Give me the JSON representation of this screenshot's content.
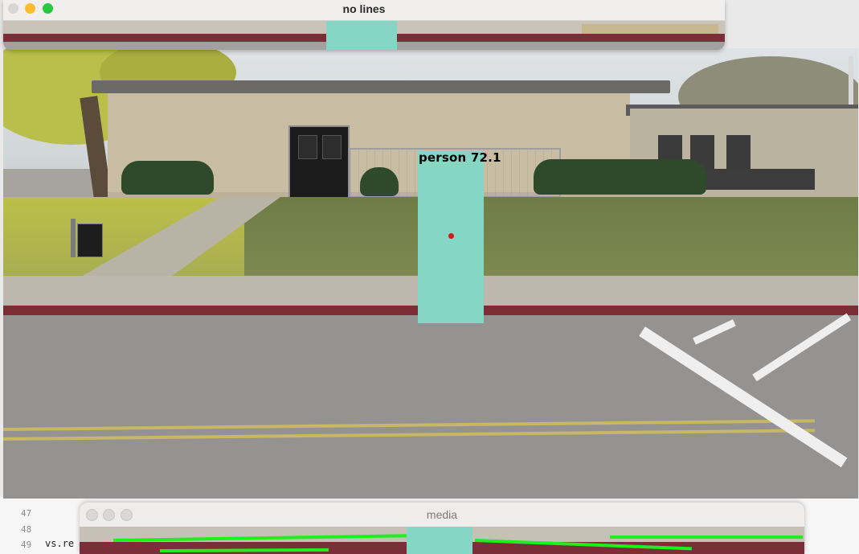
{
  "windows": {
    "video_top": {
      "title": "no lines"
    },
    "video_main": {
      "detection": {
        "label": "person",
        "confidence": "72.1"
      }
    },
    "media": {
      "title": "media"
    }
  },
  "editor": {
    "lines": [
      {
        "num": "47",
        "code": ""
      },
      {
        "num": "48",
        "code": ""
      },
      {
        "num": "49",
        "code": "vs.re"
      }
    ]
  },
  "colors": {
    "detection_box": "#85d6c4",
    "center_dot": "#d21b1b",
    "lane_overlay": "#1df01d",
    "traffic_close": "#ff5f57",
    "traffic_min": "#febc2e",
    "traffic_max": "#28c840"
  }
}
